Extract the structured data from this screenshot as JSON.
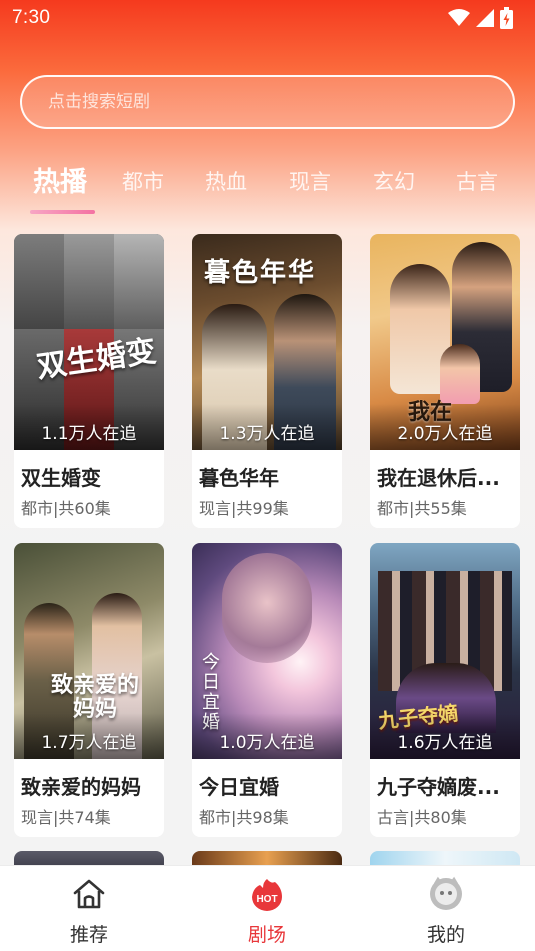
{
  "status_bar": {
    "time": "7:30"
  },
  "search": {
    "placeholder": "点击搜索短剧"
  },
  "tabs": [
    {
      "label": "热播",
      "active": true
    },
    {
      "label": "都市",
      "active": false
    },
    {
      "label": "热血",
      "active": false
    },
    {
      "label": "现言",
      "active": false
    },
    {
      "label": "玄幻",
      "active": false
    },
    {
      "label": "古言",
      "active": false
    }
  ],
  "dramas": [
    {
      "title": "双生婚变",
      "meta": "都市|共60集",
      "followers": "1.1万人在追",
      "poster_text": "双生婚变"
    },
    {
      "title": "暮色华年",
      "meta": "现言|共99集",
      "followers": "1.3万人在追",
      "poster_text": "暮色年华"
    },
    {
      "title": "我在退休后...",
      "meta": "都市|共55集",
      "followers": "2.0万人在追",
      "poster_text": "我在"
    },
    {
      "title": "致亲爱的妈妈",
      "meta": "现言|共74集",
      "followers": "1.7万人在追",
      "poster_text": "致亲爱的妈妈"
    },
    {
      "title": "今日宜婚",
      "meta": "都市|共98集",
      "followers": "1.0万人在追",
      "poster_text": "今日宜婚"
    },
    {
      "title": "九子夺嫡废...",
      "meta": "古言|共80集",
      "followers": "1.6万人在追",
      "poster_text": "九子夺嫡"
    }
  ],
  "bottom_nav": [
    {
      "label": "推荐",
      "icon": "home-icon",
      "active": false
    },
    {
      "label": "剧场",
      "icon": "hot-theater-icon",
      "badge": "HOT",
      "active": true
    },
    {
      "label": "我的",
      "icon": "profile-face-icon",
      "active": false
    }
  ],
  "colors": {
    "accent": "#e8373a",
    "header_top": "#f53a1e",
    "tab_indicator": "#f472a2"
  }
}
